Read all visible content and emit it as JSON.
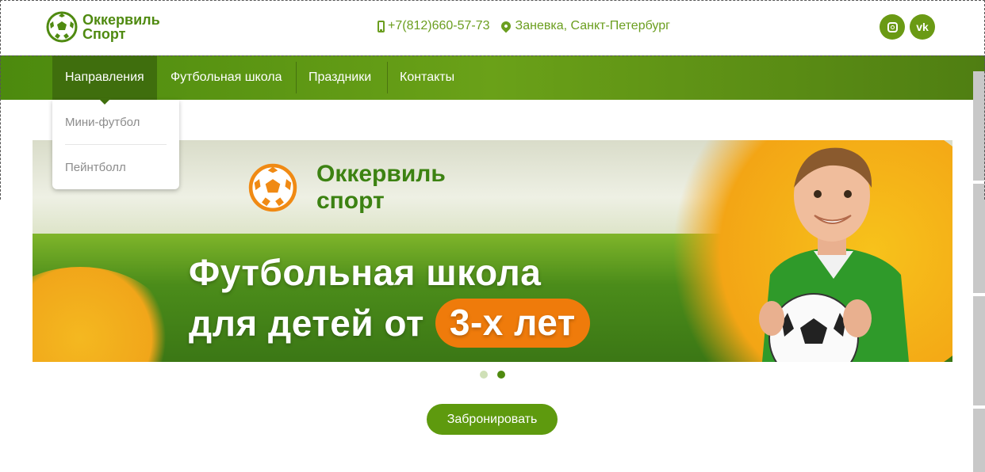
{
  "header": {
    "logo_line1": "Оккервиль",
    "logo_line2": "Спорт",
    "phone": "+7(812)660-57-73",
    "address": "Заневка, Санкт-Петербург",
    "social_vk": "vk"
  },
  "nav": {
    "items": [
      {
        "label": "Направления"
      },
      {
        "label": "Футбольная школа"
      },
      {
        "label": "Праздники"
      },
      {
        "label": "Контакты"
      }
    ],
    "dropdown": [
      {
        "label": "Мини-футбол"
      },
      {
        "label": "Пейнтболл"
      }
    ]
  },
  "banner": {
    "logo_line1": "Оккервиль",
    "logo_line2": "спорт",
    "title_line1": "Футбольная школа",
    "title_line2": "для детей от",
    "title_highlight": "3-х лет"
  },
  "actions": {
    "book_label": "Забронировать"
  },
  "colors": {
    "brand_green": "#5e9a0e",
    "accent_orange": "#ef7b0b"
  }
}
